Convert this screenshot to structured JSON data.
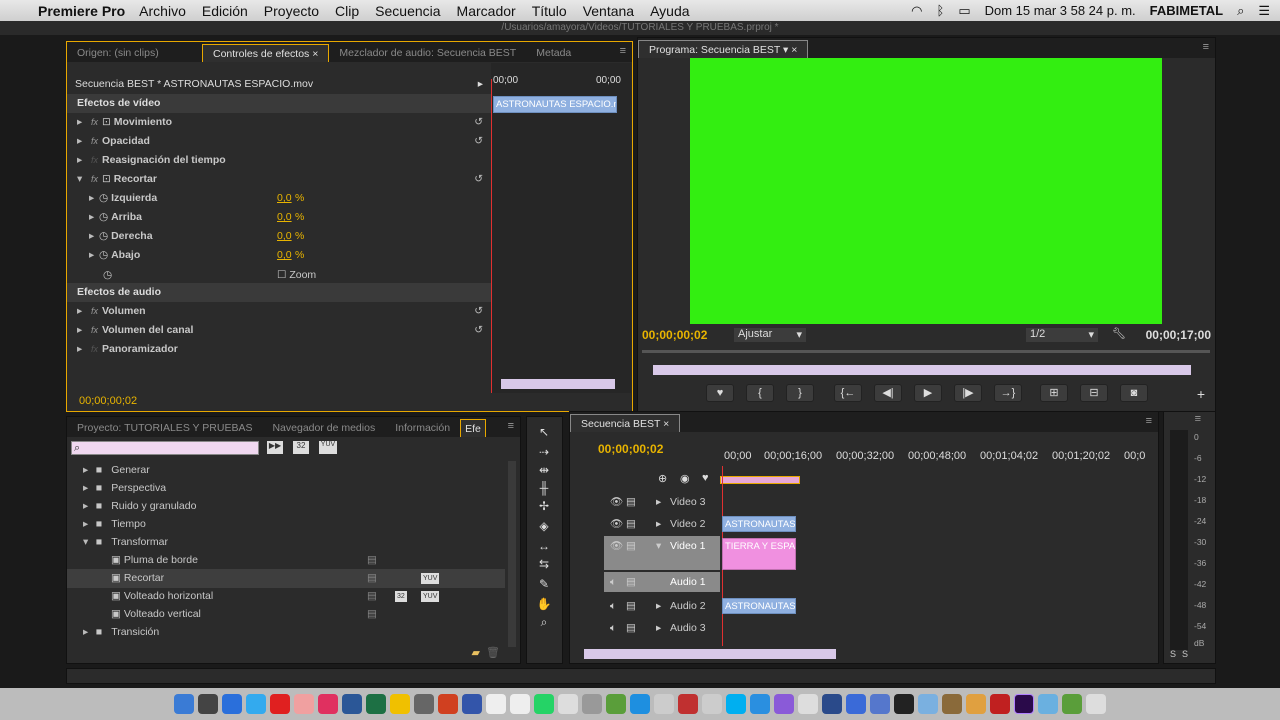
{
  "menubar": {
    "app": "Premiere Pro",
    "items": [
      "Archivo",
      "Edición",
      "Proyecto",
      "Clip",
      "Secuencia",
      "Marcador",
      "Título",
      "Ventana",
      "Ayuda"
    ],
    "datetime": "Dom 15 mar  3 58 24 p. m.",
    "user": "FABIMETAL"
  },
  "path": "/Usuarios/amayora/Videos/TUTORIALES Y PRUEBAS.prproj *",
  "source_panel": {
    "tabs": [
      "Origen: (sin clips)",
      "Controles de efectos",
      "Mezclador de audio: Secuencia BEST",
      "Metada"
    ],
    "clip_title": "Secuencia BEST * ASTRONAUTAS ESPACIO.mov",
    "time_start": "00;00",
    "time_end": "00;00",
    "clip_bar": "ASTRONAUTAS ESPACIO.m",
    "video_header": "Efectos de vídeo",
    "audio_header": "Efectos de audio",
    "effects": [
      "Movimiento",
      "Opacidad",
      "Reasignación del tiempo",
      "Recortar"
    ],
    "params": [
      {
        "name": "Izquierda",
        "value": "0,0",
        "unit": "%"
      },
      {
        "name": "Arriba",
        "value": "0,0",
        "unit": "%"
      },
      {
        "name": "Derecha",
        "value": "0,0",
        "unit": "%"
      },
      {
        "name": "Abajo",
        "value": "0,0",
        "unit": "%"
      }
    ],
    "zoom_label": "Zoom",
    "audio_effects": [
      "Volumen",
      "Volumen del canal",
      "Panoramizador"
    ],
    "timecode": "00;00;00;02"
  },
  "program": {
    "tab": "Programa: Secuencia BEST",
    "timecode_in": "00;00;00;02",
    "fit": "Ajustar",
    "quality": "1/2",
    "duration": "00;00;17;00",
    "screen_color": "#33ee11"
  },
  "project": {
    "tabs": [
      "Proyecto: TUTORIALES Y PRUEBAS",
      "Navegador de medios",
      "Información",
      "Efe"
    ],
    "search_placeholder": "",
    "badges": [
      "32",
      "YUV"
    ],
    "folders": [
      {
        "label": "Generar",
        "indent": 0
      },
      {
        "label": "Perspectiva",
        "indent": 0
      },
      {
        "label": "Ruido y granulado",
        "indent": 0
      },
      {
        "label": "Tiempo",
        "indent": 0
      },
      {
        "label": "Transformar",
        "indent": 0,
        "open": true
      },
      {
        "label": "Pluma de borde",
        "indent": 1
      },
      {
        "label": "Recortar",
        "indent": 1,
        "selected": true
      },
      {
        "label": "Volteado horizontal",
        "indent": 1
      },
      {
        "label": "Volteado vertical",
        "indent": 1
      },
      {
        "label": "Transición",
        "indent": 0
      }
    ],
    "item_badges": {
      "recortar": "YUV",
      "volteado_32": "32",
      "volteado_yuv": "YUV"
    }
  },
  "timeline": {
    "tab": "Secuencia BEST",
    "timecode": "00;00;00;02",
    "ruler": [
      "00;00",
      "00;00;16;00",
      "00;00;32;00",
      "00;00;48;00",
      "00;01;04;02",
      "00;01;20;02",
      "00;0"
    ],
    "tracks": [
      {
        "name": "Video 3"
      },
      {
        "name": "Video 2",
        "clip": "ASTRONAUTAS"
      },
      {
        "name": "Video 1",
        "clip": "TIERRA Y ESPAC"
      },
      {
        "name": "Audio 1"
      },
      {
        "name": "Audio 2",
        "clip": "ASTRONAUTAS"
      },
      {
        "name": "Audio 3"
      }
    ]
  },
  "meter": {
    "scale": [
      "0",
      "-6",
      "-12",
      "-18",
      "-24",
      "-30",
      "-36",
      "-42",
      "-48",
      "-54",
      "dB"
    ],
    "buttons": [
      "S",
      "S"
    ]
  }
}
